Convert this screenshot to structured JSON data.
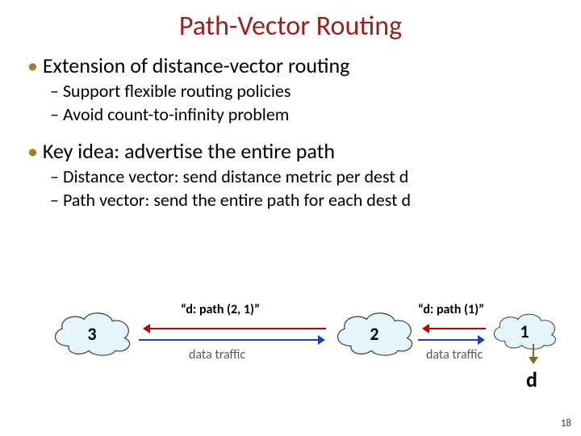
{
  "title": "Path-Vector Routing",
  "bullets": {
    "b1a": "Extension of distance-vector routing",
    "b2a": "Support flexible routing policies",
    "b2b": "Avoid count-to-infinity problem",
    "b1b": "Key idea: advertise the entire path",
    "b2c": "Distance vector: send distance metric per dest d",
    "b2d": "Path vector: send the entire path for each dest d"
  },
  "diagram": {
    "cloud3": "3",
    "cloud2": "2",
    "cloud1": "1",
    "path_left": "“d: path (2, 1)”",
    "path_right": "“d: path (1)”",
    "traffic_left": "data traffic",
    "traffic_right": "data traffic",
    "dest": "d"
  },
  "page": "18"
}
